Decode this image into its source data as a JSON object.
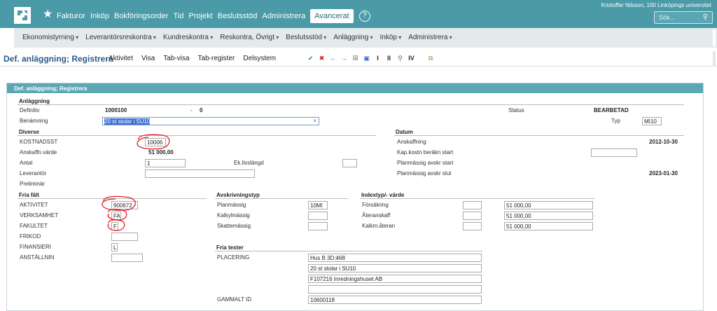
{
  "top_nav": {
    "items": [
      "Fakturor",
      "Inköp",
      "Bokföringsorder",
      "Tid",
      "Projekt",
      "Beslutsstöd",
      "Administrera"
    ],
    "active": "Avancerat",
    "help": "?",
    "user": "Kristoffer Nilsson, 100 Linköpings universitet",
    "search_placeholder": "Sök..."
  },
  "sub_nav": {
    "items": [
      "Ekonomistyrning",
      "Leverantörsreskontra",
      "Kundreskontra",
      "Reskontra, Övrigt",
      "Beslutsstöd",
      "Anläggning",
      "Inköp",
      "Administrera"
    ]
  },
  "toolbar": {
    "title": "Def. anläggning; Registrera",
    "tabs": [
      "Aktivitet",
      "Visa",
      "Tab-visa",
      "Tab-register",
      "Delsystem"
    ],
    "icons": [
      "check-icon",
      "delete-icon",
      "arrow-left-icon",
      "arrow-right-icon",
      "trash-icon",
      "save-icon",
      "text-cursor-icon",
      "double-text-icon",
      "search-icon",
      "roman-iv-icon"
    ],
    "icon_glyphs": [
      "✔",
      "✖",
      "←",
      "→",
      "☒",
      "▣",
      "I",
      "II",
      "⚲",
      "IV"
    ],
    "icon_colors": [
      "#2a9a2a",
      "#cc2222",
      "#3a6ac8",
      "#3a6ac8",
      "#555555",
      "#3a6ac8",
      "#222222",
      "#222222",
      "#555555",
      "#222222"
    ]
  },
  "panel": {
    "title": "Def. anläggning; Registrera",
    "anlaggning": {
      "heading": "Anläggning",
      "definitiv_label": "Definitiv",
      "definitiv_value": "1000100",
      "dash": "-",
      "definitiv_sub": "0",
      "status_label": "Status",
      "status_value": "BEARBETAD",
      "benamning_label": "Benämning",
      "benamning_value": "20 st stolar i SU10",
      "typ_label": "Typ",
      "typ_value": "MI10"
    },
    "diverse": {
      "heading": "Diverse",
      "kostnadsst_label": "KOSTNADSST",
      "kostnadsst_value": "10006",
      "anskaffn_label": "Anskaffn.värde",
      "anskaffn_value": "51 000,00",
      "antal_label": "Antal",
      "antal_value": "1",
      "ek_label": "Ek.livslängd",
      "ek_value": "",
      "leverantor_label": "Leverantör",
      "leverantor_value": "",
      "preliminar_label": "Preliminär"
    },
    "datum": {
      "heading": "Datum",
      "anskaffning_label": "Anskaffning",
      "anskaffning_value": "2012-10-30",
      "kap_label": "Kap.kostn beräkn start",
      "kap_value": "",
      "avskr_start_label": "Planmässig avskr start",
      "avskr_slut_label": "Planmässig avskr slut",
      "avskr_slut_value": "2023-01-30"
    },
    "fria_falt": {
      "heading": "Fria fält",
      "aktivitet_label": "AKTIVITET",
      "aktivitet_value": "900672",
      "verksamhet_label": "VERKSAMHET",
      "verksamhet_value": "FA",
      "fakultet_label": "FAKULTET",
      "fakultet_value": "F",
      "frikod_label": "FRIKOD",
      "frikod_value": "",
      "finansieri_label": "FINANSIERI",
      "finansieri_value": "L",
      "anstallnin_label": "ANSTÄLLNIN",
      "anstallnin_value": ""
    },
    "avskrivningstyp": {
      "heading": "Avskrivningstyp",
      "planmassig_label": "Planmässig",
      "planmassig_value": "10MI",
      "kalkylmassig_label": "Kalkylmässig",
      "kalkylmassig_value": "",
      "skattemassig_label": "Skattemässig",
      "skattemassig_value": ""
    },
    "index": {
      "heading": "Indextyp/- värde",
      "forsakring_label": "Försäkring",
      "forsakring_value": "51 000,00",
      "ateranskaff_label": "Återanskaff",
      "ateranskaff_value": "51 000,00",
      "kalkm_label": "Kalkm.återan",
      "kalkm_value": "51 000,00"
    },
    "fria_texter": {
      "heading": "Fria texter",
      "placering_label": "PLACERING",
      "lines": [
        "Hus B 3D:468",
        "20 st stolar i SU10",
        "F107216  Inredningshuset AB",
        ""
      ],
      "gammalt_label": "GAMMALT ID",
      "gammalt_value": "10600118"
    }
  },
  "annotation_color": "#e0202a"
}
